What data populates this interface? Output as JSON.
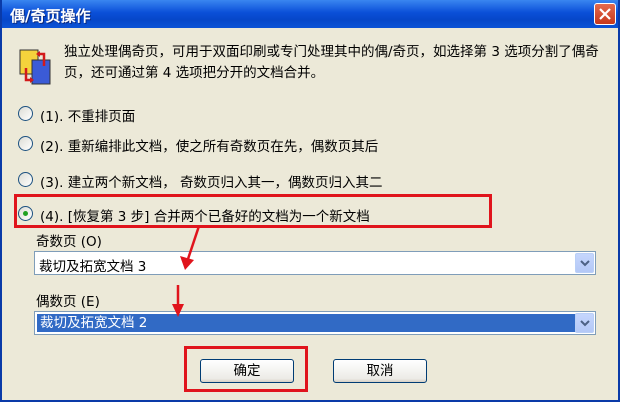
{
  "window": {
    "title": "偶/奇页操作"
  },
  "description": "独立处理偶奇页，可用于双面印刷或专门处理其中的偶/奇页，如选择第 3 选项分割了偶奇页，还可通过第 4 选项把分开的文档合并。",
  "options": [
    {
      "label": "(1). 不重排页面",
      "checked": false
    },
    {
      "label": "(2). 重新编排此文档，使之所有奇数页在先，偶数页其后",
      "checked": false
    },
    {
      "label": "(3). 建立两个新文档， 奇数页归入其一，偶数页归入其二",
      "checked": false
    },
    {
      "label": "(4). [恢复第 3 步] 合并两个已备好的文档为一个新文档",
      "checked": true
    }
  ],
  "odd_pages": {
    "label": "奇数页 (O)",
    "value": "裁切及拓宽文档 3"
  },
  "even_pages": {
    "label": "偶数页 (E)",
    "value": "裁切及拓宽文档 2"
  },
  "buttons": {
    "ok": "确定",
    "cancel": "取消"
  },
  "colors": {
    "titlebar": "#0a4fd8",
    "annotation": "#e0141c",
    "selection": "#316ac5"
  }
}
